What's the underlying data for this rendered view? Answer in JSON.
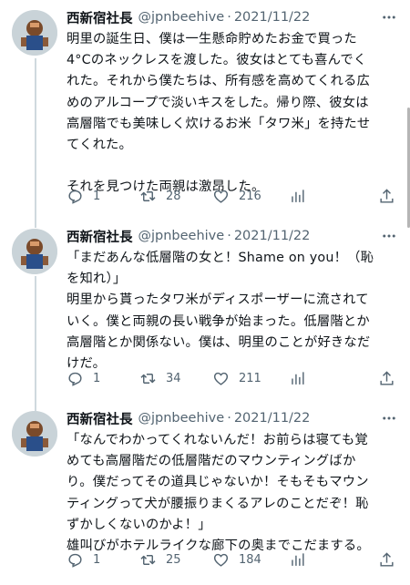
{
  "tweets": [
    {
      "author": "西新宿社長",
      "handle": "@jpnbeehive",
      "separator": "·",
      "date": "2021/11/22",
      "lines": [
        "明里の誕生日、僕は一生懸命貯めたお金で買った",
        "4°Cのネックレスを渡した。彼女はとても喜んでく",
        "れた。それから僕たちは、所有感を高めてくれる広",
        "めのアルコープで淡いキスをした。帰り際、彼女は",
        "高層階でも美味しく炊けるお米「タワ米」を持たせ",
        "てくれた。",
        "",
        "それを見つけた両親は激昂した。"
      ],
      "replies": "1",
      "retweets": "28",
      "likes": "216"
    },
    {
      "author": "西新宿社長",
      "handle": "@jpnbeehive",
      "separator": "·",
      "date": "2021/11/22",
      "lines": [
        "「まだあんな低層階の女と！Shame on you！（恥",
        "を知れ）」",
        "明里から貰ったタワ米がディスポーザーに流されて",
        "いく。僕と両親の長い戦争が始まった。低層階とか",
        "高層階とか関係ない。僕は、明里のことが好きなだ",
        "けだ。"
      ],
      "replies": "1",
      "retweets": "34",
      "likes": "211"
    },
    {
      "author": "西新宿社長",
      "handle": "@jpnbeehive",
      "separator": "·",
      "date": "2021/11/22",
      "lines": [
        "「なんでわかってくれないんだ！お前らは寝ても覚",
        "めても高層階だの低層階だのマウンティングばか",
        "り。僕だってその道具じゃないか！そもそもマウン",
        "ティングって犬が腰振りまくるアレのことだぞ！恥",
        "ずかしくないのかよ！」",
        "雄叫びがホテルライクな廊下の奥までこだまする。"
      ],
      "replies": "1",
      "retweets": "25",
      "likes": "184"
    }
  ],
  "icons": {
    "more": "more-icon",
    "reply": "reply-icon",
    "retweet": "retweet-icon",
    "like": "heart-icon",
    "stats": "stats-icon",
    "share": "share-icon"
  },
  "colors": {
    "text": "#0f1419",
    "secondary": "#536471",
    "thread_line": "#cfd9de"
  }
}
